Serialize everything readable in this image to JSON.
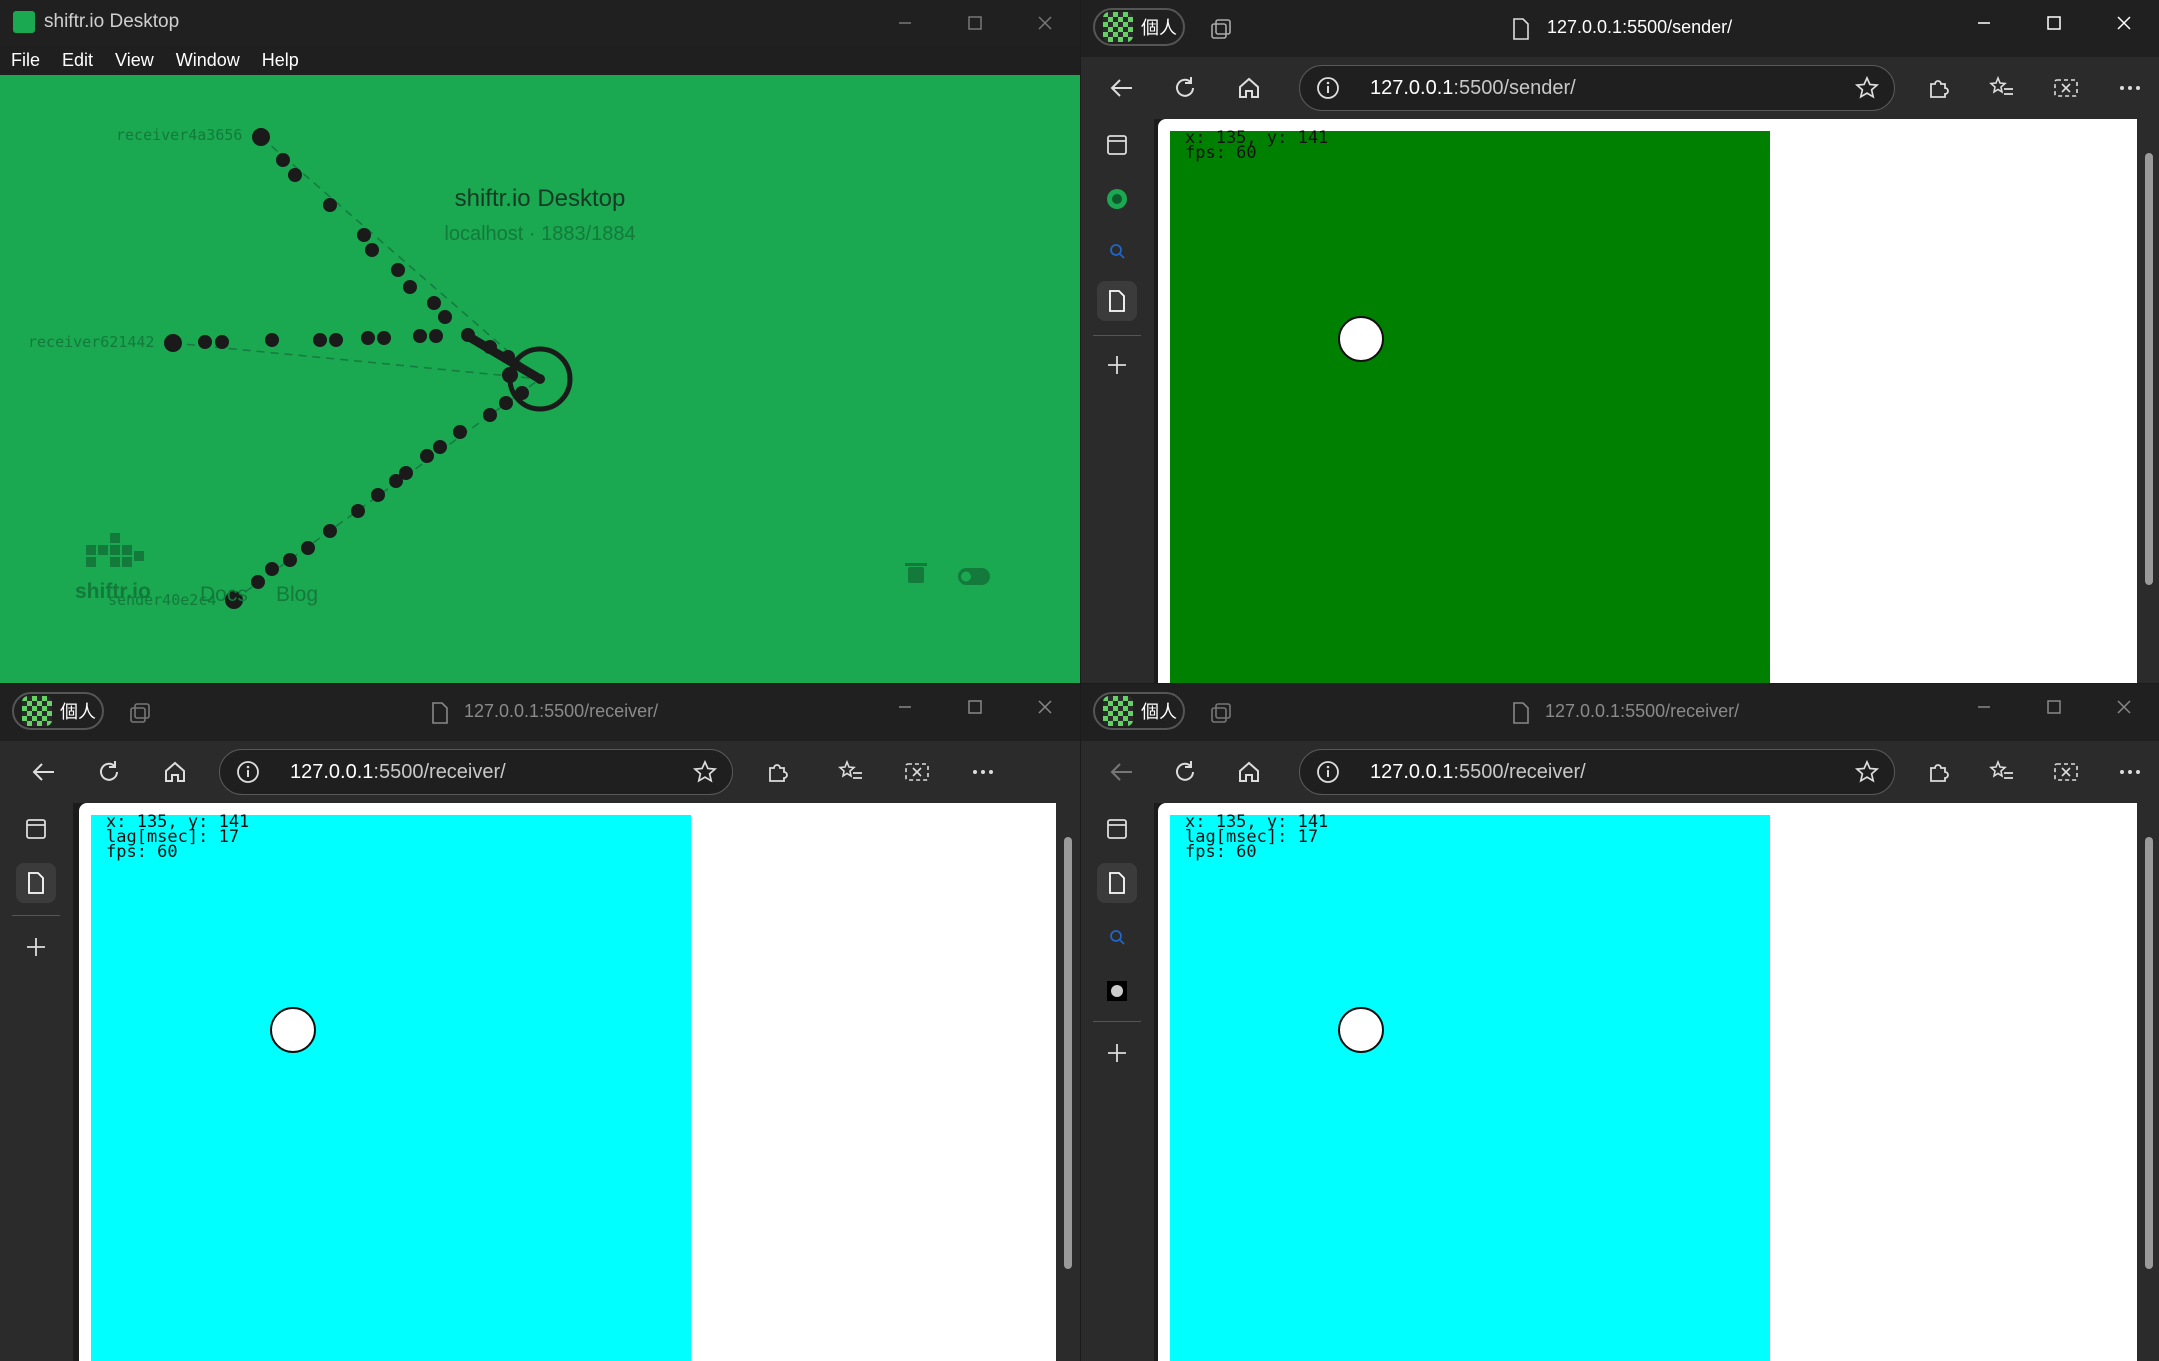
{
  "shiftr": {
    "title": "shiftr.io Desktop",
    "menu": [
      "File",
      "Edit",
      "View",
      "Window",
      "Help"
    ],
    "heading": "shiftr.io Desktop",
    "subheading": "localhost · 1883/1884",
    "clients": [
      "receiver4a3656",
      "receiver621442",
      "sender40e2c4"
    ],
    "brand": "shiftr.io",
    "links": [
      "Docs",
      "Blog"
    ],
    "colors": {
      "canvas": "#1aa851",
      "node": "#1a1a1a"
    }
  },
  "sender": {
    "profile": "個人",
    "tab_url": "127.0.0.1:5500/sender/",
    "address_host": "127.0.0.1",
    "address_rest": ":5500/sender/",
    "canvas_color": "#008000",
    "overlay": [
      "x: 135, y: 141",
      "fps: 60"
    ]
  },
  "receiver1": {
    "profile": "個人",
    "tab_url": "127.0.0.1:5500/receiver/",
    "address_host": "127.0.0.1",
    "address_rest": ":5500/receiver/",
    "canvas_color": "#00ffff",
    "overlay": [
      "x: 135, y: 141",
      "lag[msec]: 17",
      "fps: 60"
    ]
  },
  "receiver2": {
    "profile": "個人",
    "tab_url": "127.0.0.1:5500/receiver/",
    "address_host": "127.0.0.1",
    "address_rest": ":5500/receiver/",
    "canvas_color": "#00ffff",
    "overlay": [
      "x: 135, y: 141",
      "lag[msec]: 17",
      "fps: 60"
    ]
  }
}
